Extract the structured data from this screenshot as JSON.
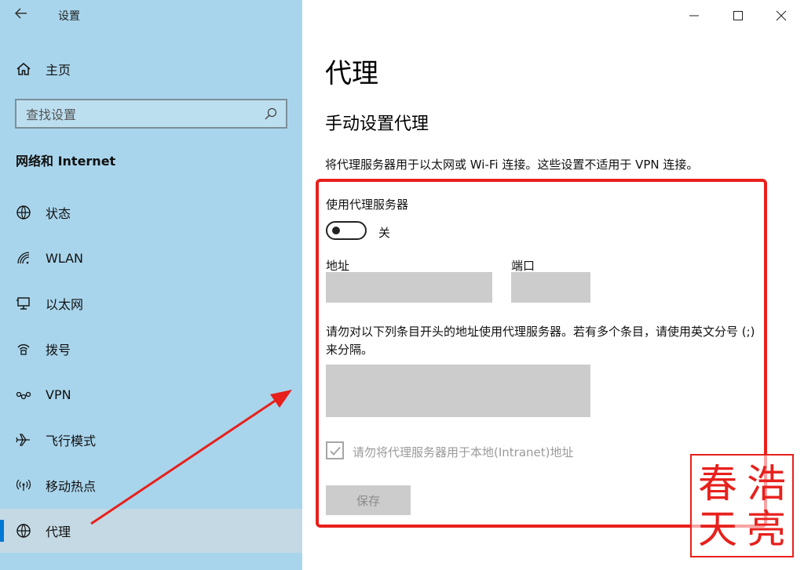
{
  "window": {
    "app_title": "设置"
  },
  "sidebar": {
    "home_label": "主页",
    "search_placeholder": "查找设置",
    "section_title": "网络和 Internet",
    "items": [
      {
        "label": "状态",
        "icon": "globe-status-icon"
      },
      {
        "label": "WLAN",
        "icon": "wifi-icon"
      },
      {
        "label": "以太网",
        "icon": "ethernet-icon"
      },
      {
        "label": "拨号",
        "icon": "dialup-icon"
      },
      {
        "label": "VPN",
        "icon": "vpn-icon"
      },
      {
        "label": "飞行模式",
        "icon": "airplane-icon"
      },
      {
        "label": "移动热点",
        "icon": "hotspot-icon"
      },
      {
        "label": "代理",
        "icon": "globe-icon",
        "active": true
      }
    ]
  },
  "main": {
    "page_title": "代理",
    "section_title": "手动设置代理",
    "description": "将代理服务器用于以太网或 Wi-Fi 连接。这些设置不适用于 VPN 连接。",
    "use_proxy_label": "使用代理服务器",
    "toggle_state": "关",
    "address_label": "地址",
    "address_value": "",
    "port_label": "端口",
    "port_value": "",
    "bypass_text": "请勿对以下列条目开头的地址使用代理服务器。若有多个条目，请使用英文分号 (;) 来分隔。",
    "bypass_value": "",
    "local_checkbox_label": "请勿将代理服务器用于本地(Intranet)地址",
    "local_checkbox_checked": true,
    "save_label": "保存"
  },
  "watermark": {
    "chars": [
      "春",
      "浩",
      "天",
      "亮"
    ]
  },
  "colors": {
    "sidebar_bg": "#a9d5ec",
    "accent": "#0078d4",
    "annotation_red": "#e8201c",
    "field_bg": "#cccccc"
  }
}
